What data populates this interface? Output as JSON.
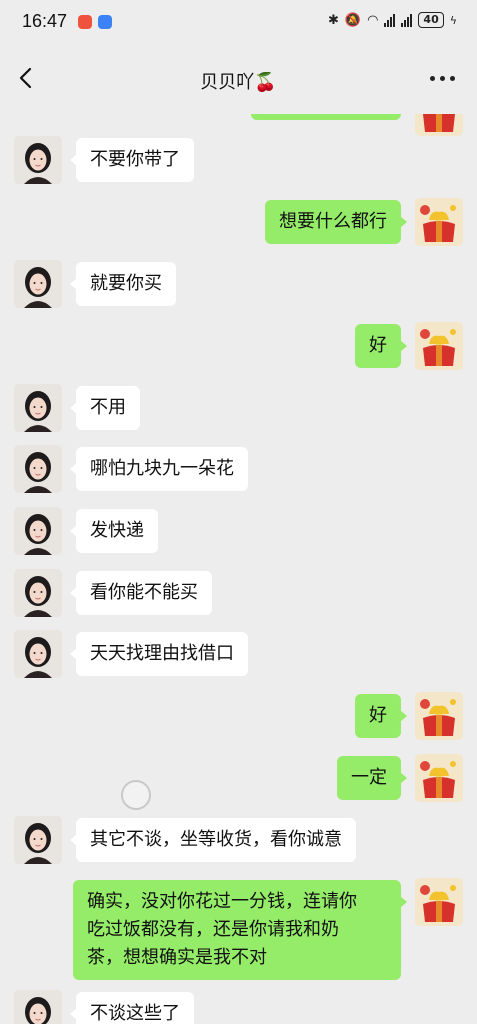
{
  "status": {
    "time": "16:47",
    "battery": "40"
  },
  "header": {
    "title": "贝贝吖🍒"
  },
  "messages": [
    {
      "side": "left",
      "text": "不要你带了"
    },
    {
      "side": "right",
      "text": "想要什么都行"
    },
    {
      "side": "left",
      "text": "就要你买"
    },
    {
      "side": "right",
      "text": "好"
    },
    {
      "side": "left",
      "text": "不用"
    },
    {
      "side": "left",
      "text": "哪怕九块九一朵花"
    },
    {
      "side": "left",
      "text": "发快递"
    },
    {
      "side": "left",
      "text": "看你能不能买"
    },
    {
      "side": "left",
      "text": "天天找理由找借口"
    },
    {
      "side": "right",
      "text": "好"
    },
    {
      "side": "right",
      "text": "一定"
    },
    {
      "side": "left",
      "text": "其它不谈，坐等收货，看你诚意"
    },
    {
      "side": "right",
      "lines": [
        "确实，没对你花过一分钱，连请你",
        "吃过饭都没有，还是你请我和奶",
        "茶，想想确实是我不对"
      ]
    },
    {
      "side": "left",
      "text": "不谈这些了"
    }
  ],
  "colors": {
    "background": "#ededed",
    "sent_bubble": "#95ec69",
    "received_bubble": "#ffffff"
  }
}
